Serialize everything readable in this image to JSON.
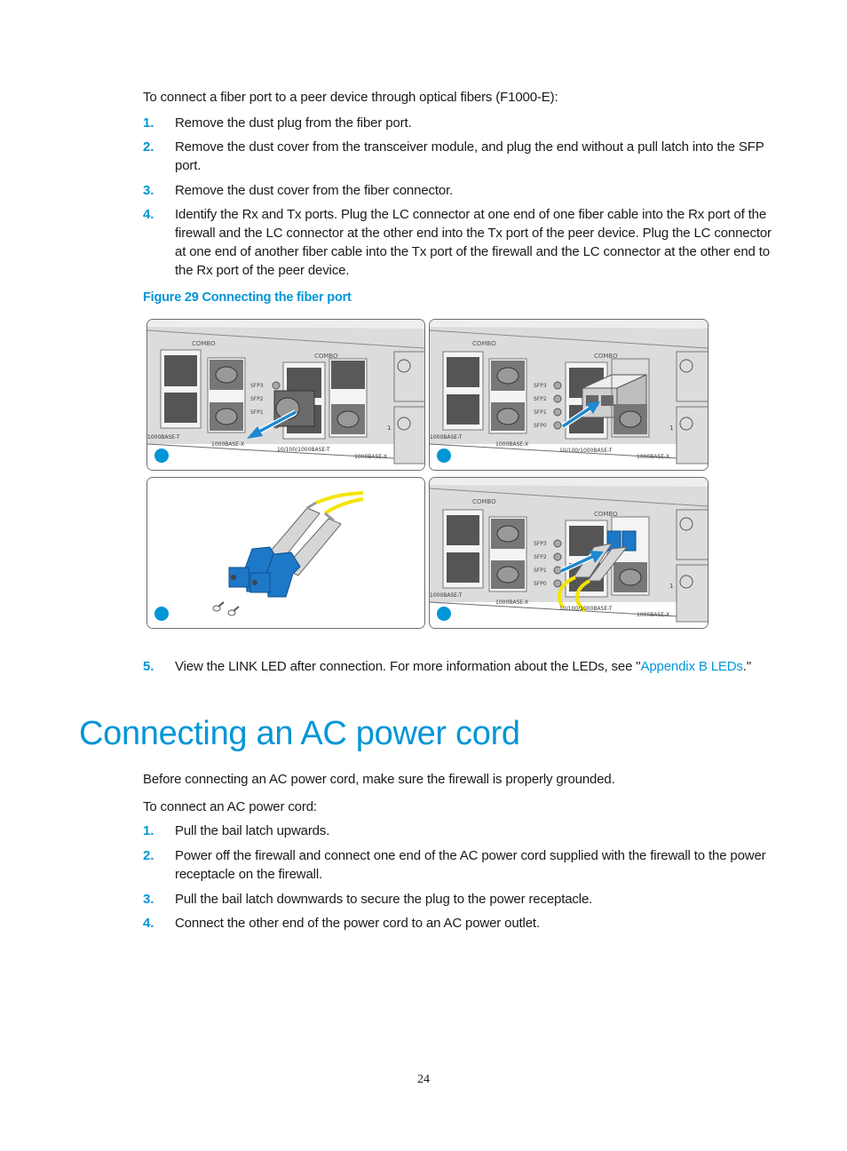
{
  "intro": "To connect a fiber port to a peer device through optical fibers (F1000-E):",
  "fiber_steps": [
    {
      "num": "1.",
      "text": "Remove the dust plug from the fiber port."
    },
    {
      "num": "2.",
      "text": "Remove the dust cover from the transceiver module, and plug the end without a pull latch into the SFP port."
    },
    {
      "num": "3.",
      "text": "Remove the dust cover from the fiber connector."
    },
    {
      "num": "4.",
      "text": "Identify the Rx and Tx ports. Plug the LC connector at one end of one fiber cable into the Rx port of the firewall and the LC connector at the other end into the Tx port of the peer device. Plug the LC connector at one end of another fiber cable into the Tx port of the firewall and the LC connector at the other end to the Rx port of the peer device."
    }
  ],
  "figure": {
    "caption": "Figure 29 Connecting the fiber port",
    "labels": {
      "combo": "COMBO",
      "sfp3": "SFP3",
      "sfp2": "SFP2",
      "sfp1": "SFP1",
      "sfp0": "SFP0",
      "base_t_left": "1000BASE-T",
      "base_x": "1000BASE-X",
      "base_t_mid": "10/100/1000BASE-T",
      "base_x_right": "1000BASE-X",
      "slot_num": "1"
    },
    "colors": {
      "accent": "#0096d6",
      "fiber": "#f5e400",
      "connector": "#1e78c8"
    }
  },
  "step5": {
    "num": "5.",
    "text_before": "View the LINK LED after connection. For more information about the LEDs, see \"",
    "link": "Appendix B LEDs",
    "text_after": ".\""
  },
  "section": {
    "title": "Connecting an AC power cord",
    "para1": "Before connecting an AC power cord, make sure the firewall is properly grounded.",
    "para2": "To connect an AC power cord:",
    "steps": [
      {
        "num": "1.",
        "text": "Pull the bail latch upwards."
      },
      {
        "num": "2.",
        "text": "Power off the firewall and connect one end of the AC power cord supplied with the firewall to the power receptacle on the firewall."
      },
      {
        "num": "3.",
        "text": "Pull the bail latch downwards to secure the plug to the power receptacle."
      },
      {
        "num": "4.",
        "text": "Connect the other end of the power cord to an AC power outlet."
      }
    ]
  },
  "page_number": "24"
}
